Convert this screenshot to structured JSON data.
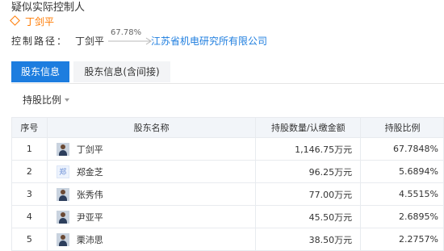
{
  "header": {
    "title": "疑似实际控制人",
    "person": "丁剑平"
  },
  "control_path": {
    "label": "控制路径：",
    "from": "丁剑平",
    "percent": "67.78%",
    "to": "江苏省机电研究所有限公司"
  },
  "tabs": [
    {
      "label": "股东信息",
      "active": true
    },
    {
      "label": "股东信息(含间接)",
      "active": false
    }
  ],
  "filter": {
    "label": "持股比例"
  },
  "table": {
    "headers": [
      "序号",
      "股东名称",
      "持股数量/认缴金额",
      "持股比例"
    ],
    "rows": [
      {
        "idx": "1",
        "name": "丁剑平",
        "avatar": "photo",
        "avatar_text": "",
        "amount": "1,146.75万元",
        "pct": "67.7848%"
      },
      {
        "idx": "2",
        "name": "郑金芝",
        "avatar": "text",
        "avatar_text": "郑",
        "amount": "96.25万元",
        "pct": "5.6894%"
      },
      {
        "idx": "3",
        "name": "张秀伟",
        "avatar": "photo",
        "avatar_text": "",
        "amount": "77.00万元",
        "pct": "4.5515%"
      },
      {
        "idx": "4",
        "name": "尹亚平",
        "avatar": "photo",
        "avatar_text": "",
        "amount": "45.50万元",
        "pct": "2.6895%"
      },
      {
        "idx": "5",
        "name": "栗沛思",
        "avatar": "photo",
        "avatar_text": "",
        "amount": "38.50万元",
        "pct": "2.2757%"
      }
    ]
  }
}
